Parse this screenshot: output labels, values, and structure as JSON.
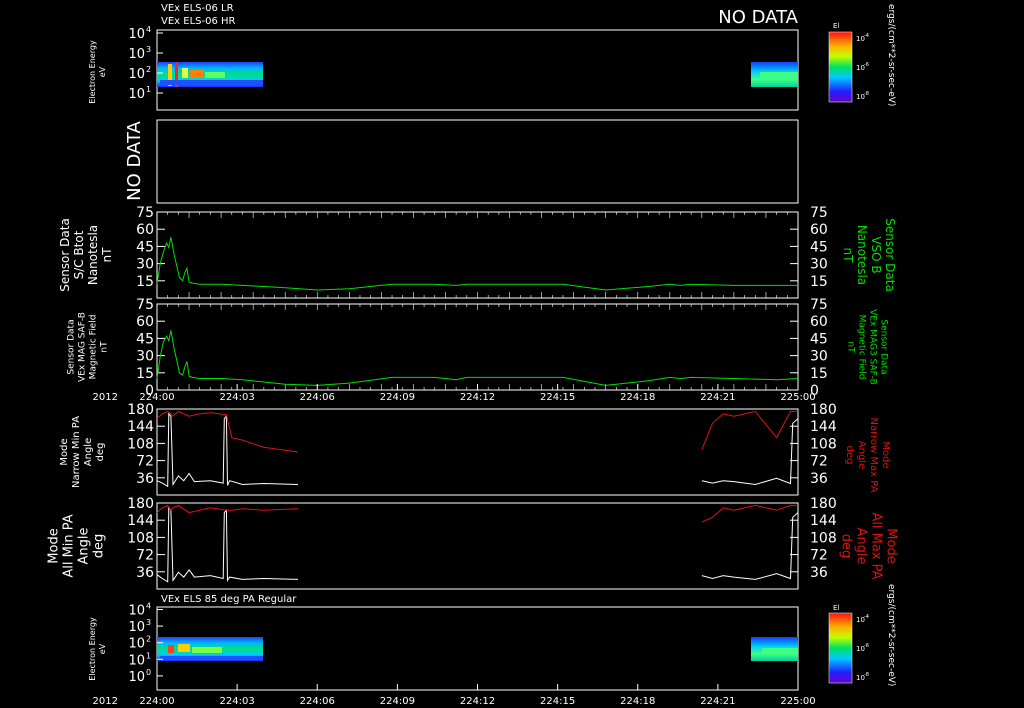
{
  "colors": {
    "background": "#000000",
    "foreground": "#ffffff",
    "green_trace": "#00e000",
    "red_trace": "#e01010",
    "white_trace": "#ffffff"
  },
  "time_axis": {
    "year": "2012",
    "ticks": [
      "224:00",
      "224:03",
      "224:06",
      "224:09",
      "224:12",
      "224:15",
      "224:18",
      "224:21",
      "225:00"
    ]
  },
  "panel1": {
    "title_lr": "VEx ELS-06 LR",
    "title_hr": "VEx ELS-06 HR",
    "no_data": "NO DATA",
    "ylabel": "Electron Energy",
    "yunit": "eV",
    "yticks": [
      {
        "b": "10",
        "e": "4"
      },
      {
        "b": "10",
        "e": "3"
      },
      {
        "b": "10",
        "e": "2"
      },
      {
        "b": "10",
        "e": "1"
      }
    ],
    "colorbar_title": "El",
    "colorbar_ticks": [
      {
        "b": "10",
        "e": "-4"
      },
      {
        "b": "10",
        "e": "-6"
      },
      {
        "b": "10",
        "e": "-8"
      }
    ],
    "colorbar_unit": "ergs/(cm**2-sr-sec-eV)"
  },
  "panel2": {
    "no_data": "NO DATA"
  },
  "panel3": {
    "ylabel_lines": [
      "Sensor Data",
      "S/C Btot",
      "Nanotesla",
      "nT"
    ],
    "right_label_lines": [
      "Sensor Data",
      "VSO B",
      "Nanotesla",
      "nT"
    ],
    "yticks": [
      "75",
      "60",
      "45",
      "30",
      "15"
    ]
  },
  "panel4": {
    "ylabel_lines": [
      "Sensor Data",
      "VEx MAG SAF-B",
      "Magnetic Field",
      "nT"
    ],
    "right_label_lines": [
      "Sensor Data",
      "VEx MAG3 SAF-B",
      "Magnetic Field",
      "nT"
    ],
    "yticks": [
      "75",
      "60",
      "45",
      "30",
      "15",
      "0"
    ]
  },
  "panel5": {
    "ylabel_lines": [
      "Mode",
      "Narrow Min PA",
      "Angle",
      "deg"
    ],
    "right_label_lines": [
      "Mode",
      "Narrow Max PA",
      "Angle",
      "deg"
    ],
    "yticks": [
      "180",
      "144",
      "108",
      "72",
      "36"
    ]
  },
  "panel6": {
    "ylabel_lines": [
      "Mode",
      "All Min PA",
      "Angle",
      "deg"
    ],
    "right_label_lines": [
      "Mode",
      "All Max PA",
      "Angle",
      "deg"
    ],
    "yticks": [
      "180",
      "144",
      "108",
      "72",
      "36"
    ]
  },
  "panel7": {
    "title": "VEx ELS 85 deg PA Regular",
    "ylabel": "Electron Energy",
    "yunit": "eV",
    "yticks": [
      {
        "b": "10",
        "e": "4"
      },
      {
        "b": "10",
        "e": "3"
      },
      {
        "b": "10",
        "e": "2"
      },
      {
        "b": "10",
        "e": "1"
      },
      {
        "b": "10",
        "e": "0"
      }
    ],
    "colorbar_title": "El",
    "colorbar_ticks": [
      {
        "b": "10",
        "e": "-4"
      },
      {
        "b": "10",
        "e": "-6"
      },
      {
        "b": "10",
        "e": "-8"
      }
    ],
    "colorbar_unit": "ergs/(cm**2-sr-sec-eV)"
  },
  "chart_data": [
    {
      "type": "heatmap",
      "title": "VEx ELS-06 LR / VEx ELS-06 HR",
      "ylabel": "Electron Energy eV",
      "ylog": true,
      "ylim": [
        5,
        10000
      ],
      "xlim": [
        0,
        60
      ],
      "x_unit": "minutes after 224:00",
      "segments": [
        {
          "x": [
            0,
            13.2
          ],
          "energy_range": [
            12,
            200
          ],
          "note": "high flux near 1-3 min"
        },
        {
          "x": [
            51.2,
            60
          ],
          "energy_range": [
            10,
            200
          ]
        }
      ],
      "colorbar": {
        "label": "El",
        "range_log10": [
          -8,
          -4
        ]
      }
    },
    {
      "type": "line",
      "ylabel": "Sensor Data S/C Btot Nanotesla nT",
      "ylim": [
        0,
        75
      ],
      "series": [
        {
          "name": "Sensor Data VSO B",
          "color": "#00e000",
          "x": [
            0,
            0.3,
            0.6,
            0.9,
            1.1,
            1.3,
            1.6,
            1.9,
            2.1,
            2.4,
            2.6,
            2.8,
            3.0,
            3.3,
            4,
            6,
            8,
            10,
            12,
            15,
            18,
            22,
            26,
            28,
            29,
            31,
            34,
            38,
            42,
            46,
            48,
            49,
            50,
            54,
            58,
            60
          ],
          "values": [
            12,
            30,
            40,
            48,
            44,
            53,
            38,
            26,
            18,
            15,
            22,
            26,
            14,
            13,
            12,
            12,
            11,
            10,
            9,
            7,
            8,
            12,
            12,
            11,
            12,
            12,
            12,
            12,
            7,
            10,
            12,
            11,
            12,
            11,
            11,
            11
          ]
        }
      ]
    },
    {
      "type": "line",
      "ylabel": "Sensor Data VEx MAG SAF-B Magnetic Field nT",
      "ylim": [
        0,
        75
      ],
      "series": [
        {
          "name": "Sensor Data VEx MAG3 SAF-B Magnetic Field",
          "color": "#00e000",
          "x": [
            0,
            0.3,
            0.6,
            0.9,
            1.1,
            1.3,
            1.6,
            1.9,
            2.1,
            2.4,
            2.6,
            2.8,
            3.0,
            3.3,
            4,
            6,
            8,
            10,
            12,
            15,
            18,
            22,
            26,
            28,
            29,
            31,
            34,
            38,
            42,
            46,
            48,
            49,
            50,
            54,
            58,
            60
          ],
          "values": [
            10,
            29,
            42,
            47,
            43,
            52,
            36,
            24,
            15,
            13,
            20,
            25,
            12,
            11,
            10,
            10,
            9,
            7,
            5,
            4,
            6,
            11,
            11,
            9,
            11,
            11,
            11,
            11,
            4,
            8,
            11,
            10,
            11,
            10,
            9,
            10
          ]
        }
      ]
    },
    {
      "type": "line",
      "ylabel": "Mode Narrow Min PA Angle deg",
      "ylim": [
        0,
        180
      ],
      "series": [
        {
          "name": "Narrow Min PA",
          "color": "#ffffff",
          "x": [
            0,
            0.5,
            1.0,
            1.1,
            1.3,
            1.5,
            2.0,
            2.5,
            3.0,
            3.5,
            5.0,
            6.2,
            6.3,
            6.5,
            6.6,
            6.8,
            8,
            10,
            13.2
          ],
          "values": [
            30,
            25,
            18,
            170,
            165,
            22,
            40,
            30,
            45,
            28,
            30,
            25,
            160,
            165,
            20,
            30,
            22,
            24,
            22
          ],
          "x2": [
            51.0,
            52,
            53,
            54,
            56,
            58,
            59.3,
            59.5,
            60
          ],
          "values2": [
            30,
            25,
            30,
            28,
            22,
            35,
            24,
            150,
            160
          ]
        },
        {
          "name": "Narrow Max PA",
          "color": "#e01010",
          "x": [
            0,
            0.5,
            1.0,
            1.3,
            1.5,
            2,
            3,
            4,
            5,
            6.5,
            7,
            8,
            10,
            13.2
          ],
          "values": [
            160,
            170,
            175,
            170,
            165,
            175,
            165,
            170,
            172,
            168,
            120,
            115,
            100,
            90
          ],
          "x2": [
            51.0,
            52,
            53,
            54,
            56,
            58,
            59.3,
            60
          ],
          "values2": [
            95,
            150,
            170,
            165,
            175,
            120,
            175,
            175
          ]
        }
      ]
    },
    {
      "type": "line",
      "ylabel": "Mode All Min PA Angle deg",
      "ylim": [
        0,
        180
      ],
      "series": [
        {
          "name": "All Min PA",
          "color": "#ffffff",
          "x": [
            0,
            0.5,
            1.0,
            1.1,
            1.3,
            1.5,
            2.0,
            2.5,
            3.0,
            3.5,
            5.0,
            6.2,
            6.3,
            6.5,
            6.6,
            6.8,
            8,
            10,
            13.2
          ],
          "values": [
            30,
            22,
            15,
            170,
            165,
            18,
            35,
            25,
            40,
            25,
            28,
            22,
            160,
            165,
            18,
            25,
            20,
            22,
            20
          ],
          "x2": [
            51.0,
            52,
            53,
            54,
            56,
            58,
            59.3,
            59.5,
            60
          ],
          "values2": [
            28,
            22,
            28,
            25,
            20,
            32,
            22,
            150,
            160
          ]
        },
        {
          "name": "All Max PA",
          "color": "#e01010",
          "x": [
            0,
            0.5,
            1.0,
            1.3,
            1.5,
            2,
            3,
            4,
            5,
            6.5,
            7,
            8,
            10,
            13.2
          ],
          "values": [
            160,
            170,
            175,
            165,
            170,
            175,
            160,
            165,
            170,
            165,
            165,
            168,
            165,
            168
          ],
          "x2": [
            51.0,
            52,
            53,
            54,
            56,
            58,
            59.3,
            60
          ],
          "values2": [
            140,
            150,
            170,
            165,
            175,
            165,
            175,
            175
          ]
        }
      ]
    },
    {
      "type": "heatmap",
      "title": "VEx ELS 85 deg PA Regular",
      "ylabel": "Electron Energy eV",
      "ylog": true,
      "ylim": [
        1,
        10000
      ],
      "xlim": [
        0,
        60
      ],
      "segments": [
        {
          "x": [
            0,
            13.2
          ],
          "energy_range": [
            8,
            200
          ]
        },
        {
          "x": [
            51.2,
            60
          ],
          "energy_range": [
            8,
            200
          ]
        }
      ],
      "colorbar": {
        "label": "El",
        "range_log10": [
          -8,
          -4
        ]
      }
    }
  ]
}
